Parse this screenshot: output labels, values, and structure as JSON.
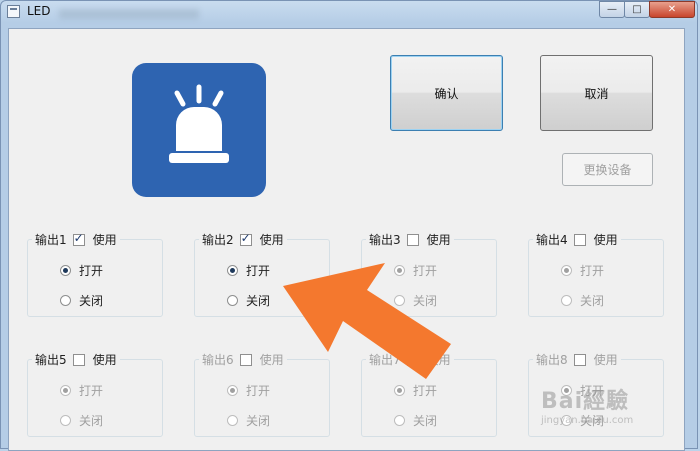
{
  "window": {
    "title": "LED",
    "minimize_glyph": "—",
    "maximize_glyph": "□",
    "close_glyph": "✕"
  },
  "buttons": {
    "confirm": "确认",
    "cancel": "取消",
    "change_device": "更换设备"
  },
  "groups": [
    {
      "label": "输出1",
      "use_label": "使用",
      "use_checked": true,
      "enabled": true,
      "open_label": "打开",
      "close_label": "关闭",
      "selected": "open"
    },
    {
      "label": "输出2",
      "use_label": "使用",
      "use_checked": true,
      "enabled": true,
      "open_label": "打开",
      "close_label": "关闭",
      "selected": "open"
    },
    {
      "label": "输出3",
      "use_label": "使用",
      "use_checked": false,
      "enabled": false,
      "open_label": "打开",
      "close_label": "关闭",
      "selected": "open"
    },
    {
      "label": "输出4",
      "use_label": "使用",
      "use_checked": false,
      "enabled": false,
      "open_label": "打开",
      "close_label": "关闭",
      "selected": "open"
    },
    {
      "label": "输出5",
      "use_label": "使用",
      "use_checked": false,
      "enabled": true,
      "open_label": "打开",
      "close_label": "关闭",
      "selected": "open"
    },
    {
      "label": "输出6",
      "use_label": "使用",
      "use_checked": false,
      "enabled": false,
      "open_label": "打开",
      "close_label": "关闭",
      "selected": "open"
    },
    {
      "label": "输出7",
      "use_label": "使用",
      "use_checked": false,
      "enabled": false,
      "open_label": "打开",
      "close_label": "关闭",
      "selected": "open"
    },
    {
      "label": "输出8",
      "use_label": "使用",
      "use_checked": false,
      "enabled": false,
      "open_label": "打开",
      "close_label": "关闭",
      "selected": "open"
    }
  ],
  "icons": {
    "led": "siren-light-icon",
    "annotation": "orange-arrow-icon"
  },
  "colors": {
    "led_tile": "#2e64b1",
    "arrow": "#f4782e",
    "confirm_border": "#3c7fb1"
  },
  "watermark": {
    "text": "Bai經驗",
    "sub": "jingyan.baidu.com"
  }
}
